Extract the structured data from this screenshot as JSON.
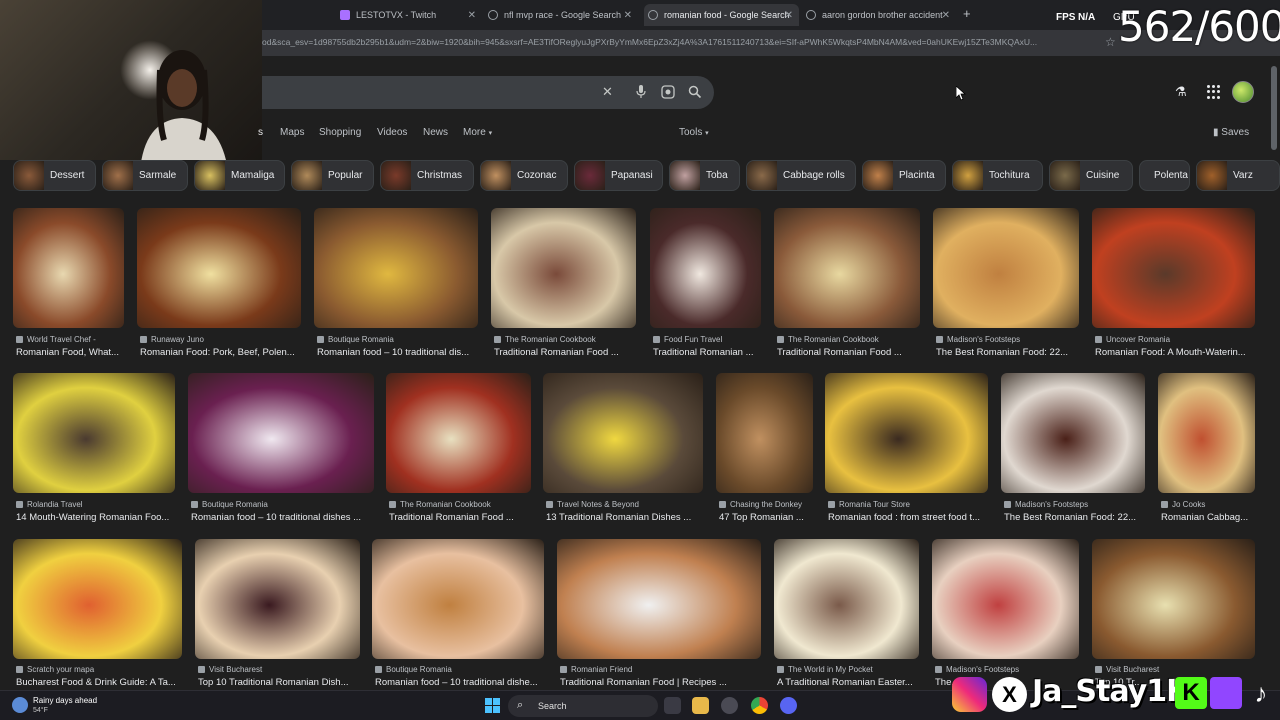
{
  "browser": {
    "tabs": [
      {
        "title": "LESTOTVX - Twitch",
        "active": false
      },
      {
        "title": "nfl mvp race - Google Search",
        "active": false
      },
      {
        "title": "romanian food - Google Search",
        "active": true
      },
      {
        "title": "aaron gordon brother accident",
        "active": false
      }
    ],
    "new_tab": "+",
    "url": "od&sca_esv=1d98755db2b295b1&udm=2&biw=1920&bih=945&sxsrf=AE3TifOReglyuJgPXrByYmMx6EpZ3xZj4A%3A1761511240713&ei=SIf-aPWhK5WkqtsP4MbN4AM&ved=0ahUKEwj15ZTe3MKQAxU..."
  },
  "overlay": {
    "fps_label": "FPS",
    "fps_value": "N/A",
    "gpu_label": "GPU",
    "counter": "562/600",
    "handle": "Ja_Stay1K"
  },
  "search": {
    "clear_icon": "✕"
  },
  "nav": {
    "tabs": [
      "s",
      "Maps",
      "Shopping",
      "Videos",
      "News",
      "More"
    ],
    "tools": "Tools",
    "saves": "Saves"
  },
  "chips": [
    {
      "label": "Dessert",
      "color": "#8a5a3a"
    },
    {
      "label": "Sarmale",
      "color": "#a0704a"
    },
    {
      "label": "Mamaliga",
      "color": "#d8c060"
    },
    {
      "label": "Popular",
      "color": "#b08a5a"
    },
    {
      "label": "Christmas",
      "color": "#7a3a2a"
    },
    {
      "label": "Cozonac",
      "color": "#c09060"
    },
    {
      "label": "Papanasi",
      "color": "#6a2a3a"
    },
    {
      "label": "Toba",
      "color": "#c0a0a0"
    },
    {
      "label": "Cabbage rolls",
      "color": "#8a6a4a"
    },
    {
      "label": "Placinta",
      "color": "#c0804a"
    },
    {
      "label": "Tochitura",
      "color": "#d0a040"
    },
    {
      "label": "Cuisine",
      "color": "#7a6a4a"
    },
    {
      "label": "Polenta",
      "color": "#e0c050"
    },
    {
      "label": "Varz",
      "color": "#a0602a"
    }
  ],
  "results": [
    {
      "source": "World Travel Chef -",
      "title": "Romanian Food, What...",
      "c1": "#e8d8b0",
      "c2": "#8a4a2a"
    },
    {
      "source": "Runaway Juno",
      "title": "Romanian Food: Pork, Beef, Polen...",
      "c1": "#f0e0a0",
      "c2": "#7a3a1a"
    },
    {
      "source": "Boutique Romania",
      "title": "Romanian food – 10 traditional dis...",
      "c1": "#e0b840",
      "c2": "#8a5a30"
    },
    {
      "source": "The Romanian Cookbook",
      "title": "Traditional Romanian Food ...",
      "c1": "#7a4a3a",
      "c2": "#d8c8a8"
    },
    {
      "source": "Food Fun Travel",
      "title": "Traditional Romanian ...",
      "c1": "#f0e8e0",
      "c2": "#4a2a2a"
    },
    {
      "source": "The Romanian Cookbook",
      "title": "Traditional Romanian Food ...",
      "c1": "#e8d8a0",
      "c2": "#8a5a3a"
    },
    {
      "source": "Madison's Footsteps",
      "title": "The Best Romanian Food: 22...",
      "c1": "#c08040",
      "c2": "#e0b060"
    },
    {
      "source": "Uncover Romania",
      "title": "Romanian Food: A Mouth-Waterin...",
      "c1": "#5a3a2a",
      "c2": "#c04020"
    },
    {
      "source": "Rolandia Travel",
      "title": "14 Mouth-Watering Romanian Foo...",
      "c1": "#4a3a30",
      "c2": "#e0d040"
    },
    {
      "source": "Boutique Romania",
      "title": "Romanian food – 10 traditional dishes ...",
      "c1": "#f0e8f0",
      "c2": "#6a2050"
    },
    {
      "source": "The Romanian Cookbook",
      "title": "Traditional Romanian Food ...",
      "c1": "#e8e0c0",
      "c2": "#a03020"
    },
    {
      "source": "Travel Notes & Beyond",
      "title": "13 Traditional Romanian Dishes ...",
      "c1": "#f0d840",
      "c2": "#5a4a3a"
    },
    {
      "source": "Chasing the Donkey",
      "title": "47 Top Romanian ...",
      "c1": "#c09060",
      "c2": "#6a4a2a"
    },
    {
      "source": "Romania Tour Store",
      "title": "Romanian food : from street food t...",
      "c1": "#3a2a20",
      "c2": "#e8c040"
    },
    {
      "source": "Madison's Footsteps",
      "title": "The Best Romanian Food: 22...",
      "c1": "#4a2018",
      "c2": "#e0d8d0"
    },
    {
      "source": "Jo Cooks",
      "title": "Romanian Cabbag...",
      "c1": "#c05030",
      "c2": "#e0c080"
    },
    {
      "source": "Scratch your mapa",
      "title": "Bucharest Food & Drink Guide: A Ta...",
      "c1": "#e06030",
      "c2": "#f0d040"
    },
    {
      "source": "Visit Bucharest",
      "title": "Top 10 Traditional Romanian Dish...",
      "c1": "#3a1a20",
      "c2": "#e8d0b0"
    },
    {
      "source": "Boutique Romania",
      "title": "Romanian food – 10 traditional dishe...",
      "c1": "#c08040",
      "c2": "#e8c0a0"
    },
    {
      "source": "Romanian Friend",
      "title": "Traditional Romanian Food | Recipes ...",
      "c1": "#f0f0f0",
      "c2": "#c08050"
    },
    {
      "source": "The World in My Pocket",
      "title": "A Traditional Romanian Easter...",
      "c1": "#7a5a4a",
      "c2": "#f0e8d0"
    },
    {
      "source": "Madison's Footsteps",
      "title": "The...",
      "c1": "#c04040",
      "c2": "#e8d0c0"
    },
    {
      "source": "Visit Bucharest",
      "title": "Top 10 Tr...",
      "c1": "#e8e0b0",
      "c2": "#8a5a30"
    }
  ],
  "taskbar": {
    "weather_title": "Rainy days ahead",
    "weather_temp": "54°F",
    "search_label": "Search"
  }
}
